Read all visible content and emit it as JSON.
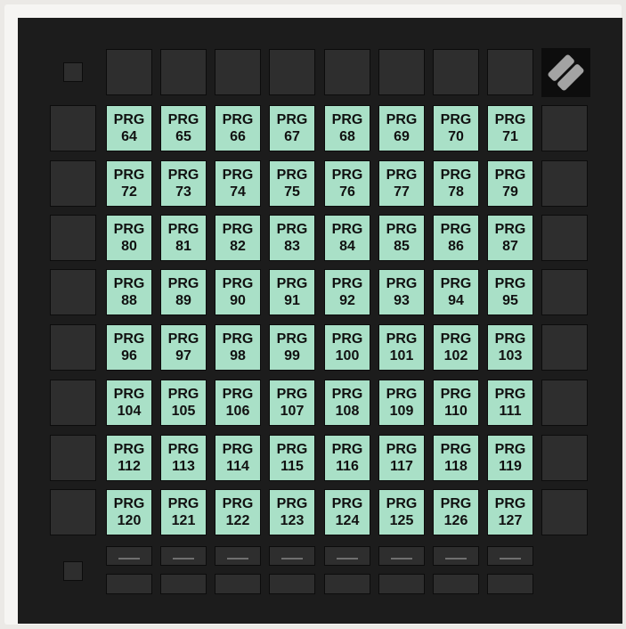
{
  "pad_prefix": "PRG",
  "pad_numbers": [
    [
      "64",
      "65",
      "66",
      "67",
      "68",
      "69",
      "70",
      "71"
    ],
    [
      "72",
      "73",
      "74",
      "75",
      "76",
      "77",
      "78",
      "79"
    ],
    [
      "80",
      "81",
      "82",
      "83",
      "84",
      "85",
      "86",
      "87"
    ],
    [
      "88",
      "89",
      "90",
      "91",
      "92",
      "93",
      "94",
      "95"
    ],
    [
      "96",
      "97",
      "98",
      "99",
      "100",
      "101",
      "102",
      "103"
    ],
    [
      "104",
      "105",
      "106",
      "107",
      "108",
      "109",
      "110",
      "111"
    ],
    [
      "112",
      "113",
      "114",
      "115",
      "116",
      "117",
      "118",
      "119"
    ],
    [
      "120",
      "121",
      "122",
      "123",
      "124",
      "125",
      "126",
      "127"
    ]
  ],
  "colors": {
    "pad_active": "#a9e0c7",
    "button_unlit": "#2e2e2e",
    "device_body": "#1c1c1c"
  },
  "icons": {
    "logo": "novation-logo-icon",
    "dash": "dash-icon"
  }
}
